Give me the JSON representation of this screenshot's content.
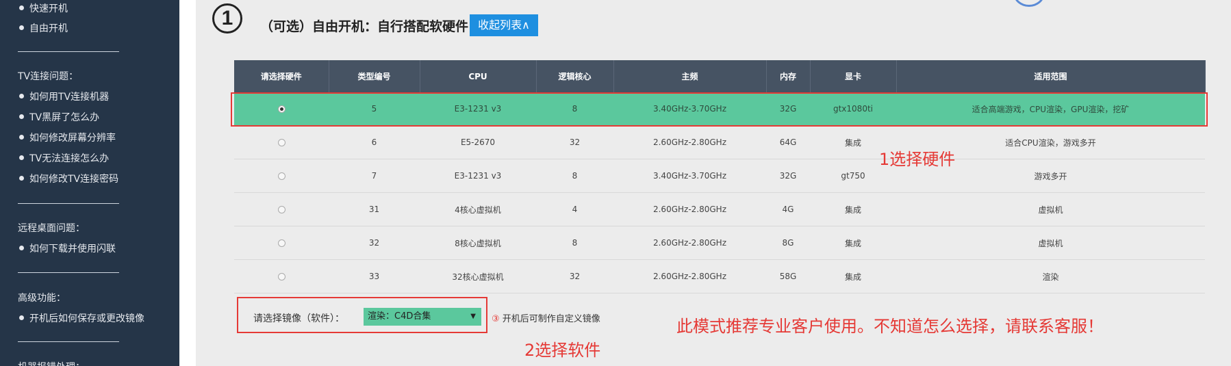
{
  "sidebar": {
    "items_top": [
      "快速开机",
      "自由开机"
    ],
    "sections": [
      {
        "heading": "TV连接问题：",
        "items": [
          "如何用TV连接机器",
          "TV黑屏了怎么办",
          "如何修改屏幕分辨率",
          "TV无法连接怎么办",
          "如何修改TV连接密码"
        ]
      },
      {
        "heading": "远程桌面问题：",
        "items": [
          "如何下载并使用闪联"
        ]
      },
      {
        "heading": "高级功能：",
        "items": [
          "开机后如何保存或更改镜像"
        ]
      },
      {
        "heading": "机器报错处理：",
        "items": []
      }
    ]
  },
  "main": {
    "step_number": "①",
    "title": "（可选）自由开机：自行搭配软硬件",
    "collapse_label": "收起列表∧"
  },
  "table": {
    "headers": [
      "请选择硬件",
      "类型编号",
      "CPU",
      "逻辑核心",
      "主频",
      "内存",
      "显卡",
      "适用范围"
    ],
    "rows": [
      {
        "selected": true,
        "cells": [
          "5",
          "E3-1231 v3",
          "8",
          "3.40GHz-3.70GHz",
          "32G",
          "gtx1080ti",
          "适合高端游戏，CPU渲染，GPU渲染，挖矿"
        ]
      },
      {
        "selected": false,
        "cells": [
          "6",
          "E5-2670",
          "32",
          "2.60GHz-2.80GHz",
          "64G",
          "集成",
          "适合CPU渲染，游戏多开"
        ]
      },
      {
        "selected": false,
        "cells": [
          "7",
          "E3-1231 v3",
          "8",
          "3.40GHz-3.70GHz",
          "32G",
          "gt750",
          "游戏多开"
        ]
      },
      {
        "selected": false,
        "cells": [
          "31",
          "4核心虚拟机",
          "4",
          "2.60GHz-2.80GHz",
          "4G",
          "集成",
          "虚拟机"
        ]
      },
      {
        "selected": false,
        "cells": [
          "32",
          "8核心虚拟机",
          "8",
          "2.60GHz-2.80GHz",
          "8G",
          "集成",
          "虚拟机"
        ]
      },
      {
        "selected": false,
        "cells": [
          "33",
          "32核心虚拟机",
          "32",
          "2.60GHz-2.80GHz",
          "58G",
          "集成",
          "渲染"
        ]
      }
    ]
  },
  "mirror": {
    "label": "请选择镜像（软件）：",
    "selected_value": "渲染：C4D合集",
    "note_number": "③",
    "note_text": "开机后可制作自定义镜像"
  },
  "annotations": {
    "step1": "1选择硬件",
    "step2": "2选择软件",
    "recommend": "此模式推荐专业客户使用。不知道怎么选择，请联系客服！"
  },
  "colors": {
    "sidebar_bg": "#253548",
    "selected_row": "#5bc89d",
    "header_bg": "#465363",
    "accent_button": "#1e8fe0",
    "annotation_red": "#e53935"
  }
}
